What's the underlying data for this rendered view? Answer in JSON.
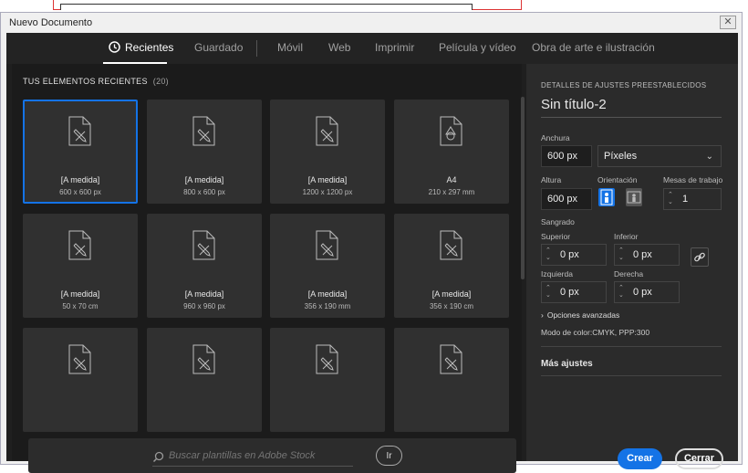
{
  "window": {
    "title": "Nuevo Documento",
    "close_glyph": "✕"
  },
  "nav": {
    "tabs": [
      {
        "label": "Recientes",
        "active": true,
        "icon": "clock-icon"
      },
      {
        "label": "Guardado"
      },
      {
        "label": "Móvil"
      },
      {
        "label": "Web"
      },
      {
        "label": "Imprimir"
      },
      {
        "label": "Película y vídeo"
      },
      {
        "label": "Obra de arte e ilustración"
      }
    ]
  },
  "recent": {
    "title": "TUS ELEMENTOS RECIENTES",
    "count": "(20)",
    "items": [
      {
        "name": "[A medida]",
        "size": "600 x 600 px",
        "selected": true,
        "icon": "document-pencil-icon"
      },
      {
        "name": "[A medida]",
        "size": "800 x 600 px",
        "icon": "document-pencil-icon"
      },
      {
        "name": "[A medida]",
        "size": "1200 x 1200 px",
        "icon": "document-pencil-icon"
      },
      {
        "name": "A4",
        "size": "210 x 297 mm",
        "icon": "document-shapes-icon"
      },
      {
        "name": "[A medida]",
        "size": "50 x 70 cm",
        "icon": "document-pencil-icon"
      },
      {
        "name": "[A medida]",
        "size": "960 x 960 px",
        "icon": "document-pencil-icon"
      },
      {
        "name": "[A medida]",
        "size": "356 x 190 mm",
        "icon": "document-pencil-icon"
      },
      {
        "name": "[A medida]",
        "size": "356 x 190 cm",
        "icon": "document-pencil-icon"
      },
      {
        "name": "",
        "size": "",
        "icon": "document-pencil-icon"
      },
      {
        "name": "",
        "size": "",
        "icon": "document-pencil-icon"
      },
      {
        "name": "",
        "size": "",
        "icon": "document-pencil-icon"
      },
      {
        "name": "",
        "size": "",
        "icon": "document-pencil-icon"
      }
    ]
  },
  "search": {
    "placeholder": "Buscar plantillas en Adobe Stock",
    "go_label": "Ir"
  },
  "preset": {
    "heading": "DETALLES DE AJUSTES PREESTABLECIDOS",
    "doc_name": "Sin título-2",
    "width_label": "Anchura",
    "width_value": "600 px",
    "unit_value": "Píxeles",
    "height_label": "Altura",
    "height_value": "600 px",
    "orientation_label": "Orientación",
    "artboards_label": "Mesas de trabajo",
    "artboards_value": "1",
    "bleed_label": "Sangrado",
    "top_label": "Superior",
    "top_value": "0 px",
    "bottom_label": "Inferior",
    "bottom_value": "0 px",
    "left_label": "Izquierda",
    "left_value": "0 px",
    "right_label": "Derecha",
    "right_value": "0 px",
    "advanced_label": "Opciones avanzadas",
    "color_mode": "Modo de color:CMYK, PPP:300",
    "more_label": "Más ajustes",
    "create_label": "Crear",
    "close_label": "Cerrar"
  },
  "colors": {
    "accent": "#1473e6",
    "panel": "#2b2b2b",
    "tile": "#303030"
  }
}
